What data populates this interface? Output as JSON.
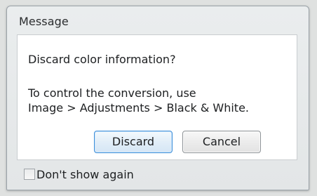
{
  "dialog": {
    "title": "Message",
    "question": "Discard color information?",
    "detail_line1": "To control the conversion, use",
    "detail_line2": "Image > Adjustments > Black & White.",
    "discard_label": "Discard",
    "cancel_label": "Cancel",
    "dont_show_label": "Don't show again",
    "dont_show_checked": false
  },
  "colors": {
    "default_button_border": "#3d8ed8",
    "content_background": "#ffffff",
    "window_background": "#e5e8e9"
  }
}
